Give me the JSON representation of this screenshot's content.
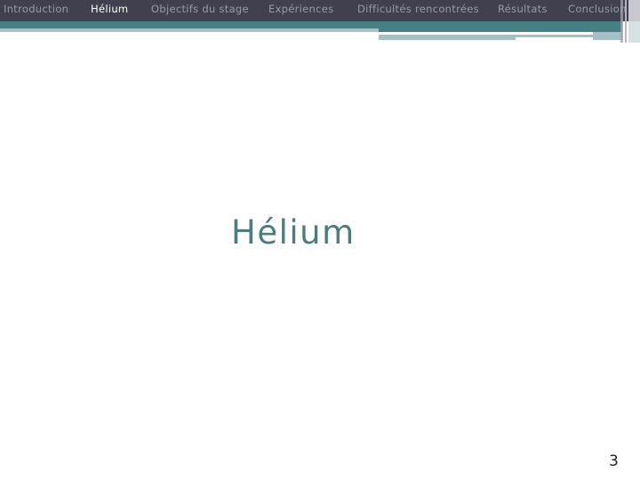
{
  "nav": {
    "items": [
      {
        "label": "Introduction",
        "active": false
      },
      {
        "label": "Hélium",
        "active": true
      },
      {
        "label": "Objectifs du stage",
        "active": false
      },
      {
        "label": "Expériences",
        "active": false
      },
      {
        "label": "Difficultés rencontrées",
        "active": false
      },
      {
        "label": "Résultats",
        "active": false
      },
      {
        "label": "Conclusion",
        "active": false
      }
    ]
  },
  "slide": {
    "title": "Hélium",
    "page_number": "3"
  },
  "colors": {
    "nav_bg": "#41404f",
    "nav_text": "#9a9aa6",
    "nav_active": "#ffffff",
    "accent_teal": "#468084",
    "accent_light": "#a6c1c5",
    "title": "#4a7c80"
  }
}
